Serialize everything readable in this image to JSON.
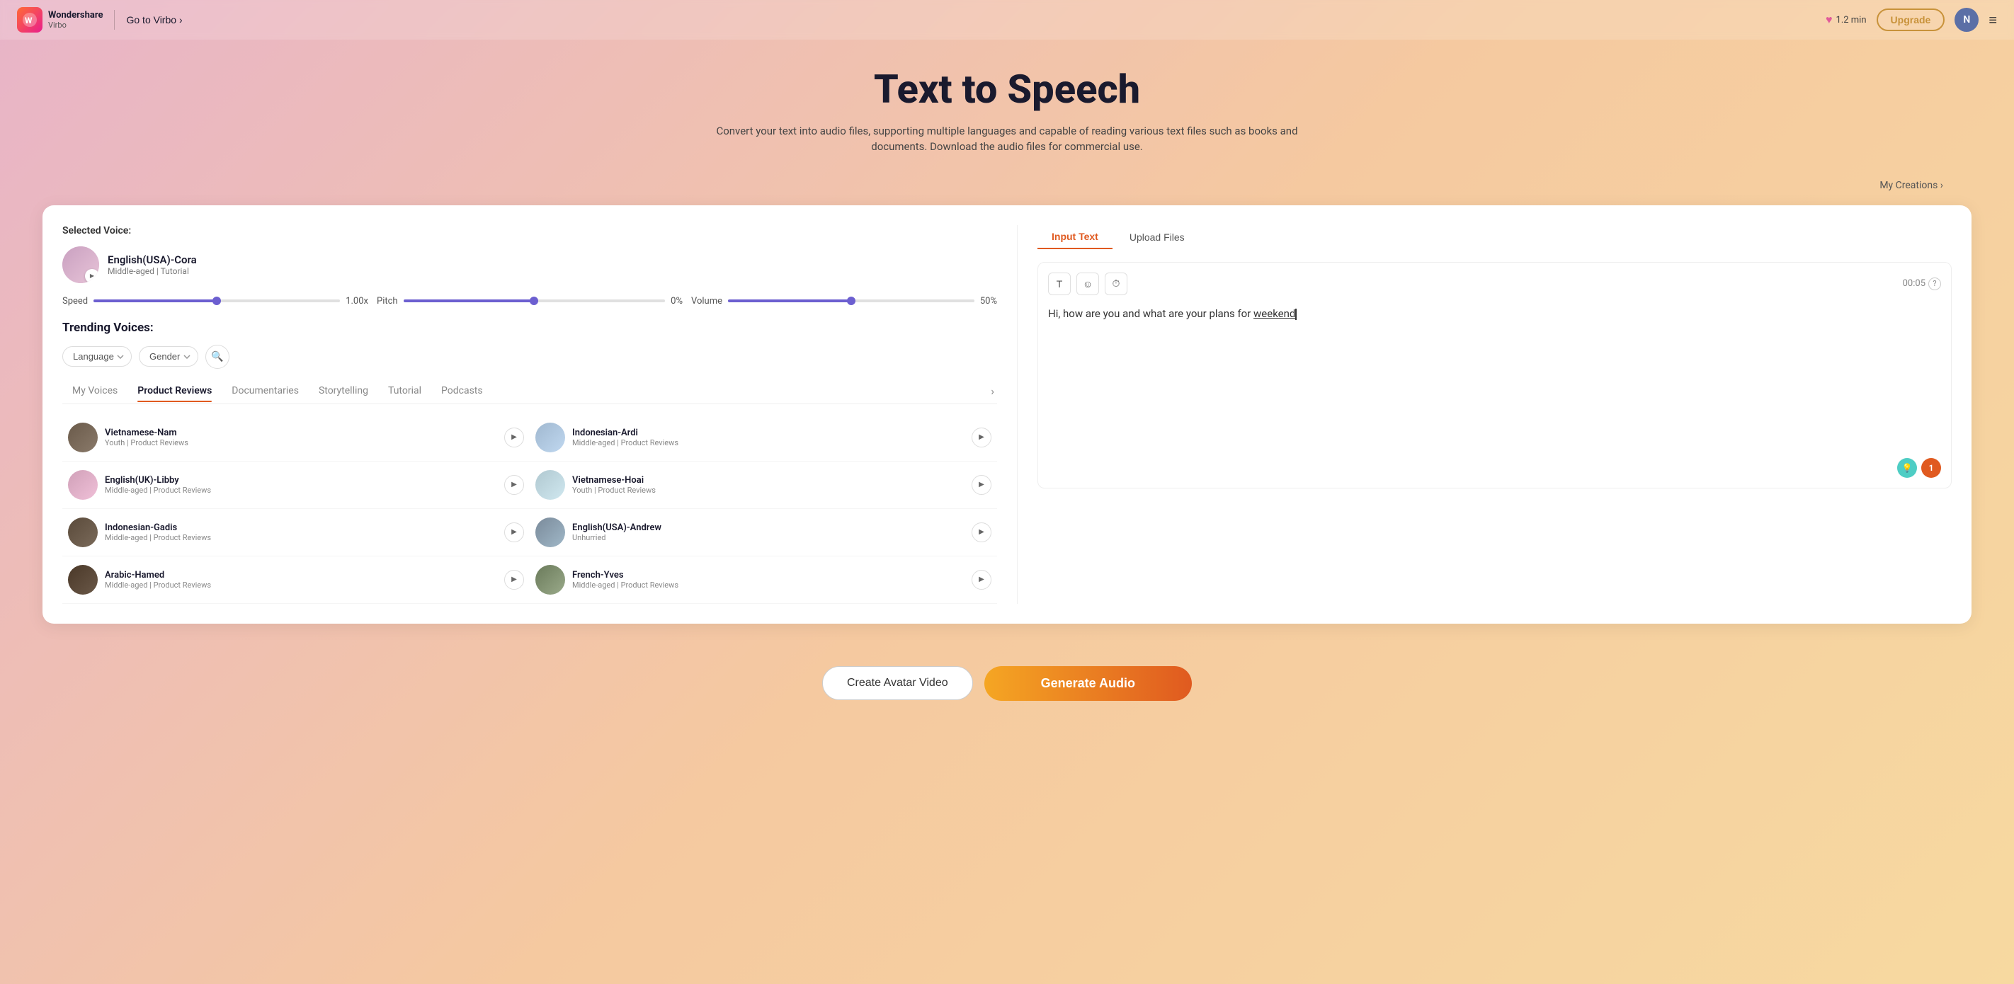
{
  "navbar": {
    "logo_text": "Wondershare",
    "logo_sub": "Virbo",
    "go_virbo_label": "Go to Virbo",
    "go_virbo_chevron": "›",
    "credits": "1.2 min",
    "upgrade_label": "Upgrade",
    "user_initial": "N",
    "menu_icon": "≡"
  },
  "hero": {
    "title": "Text to Speech",
    "subtitle": "Convert your text into audio files, supporting multiple languages and capable of reading various text files such as books and documents. Download the audio files for commercial use.",
    "my_creations_label": "My Creations ›"
  },
  "left_panel": {
    "selected_voice_label": "Selected Voice:",
    "selected_voice_name": "English(USA)-Cora",
    "selected_voice_meta": "Middle-aged | Tutorial",
    "controls": {
      "speed_label": "Speed",
      "speed_value": "1.00x",
      "speed_fill_pct": "50",
      "pitch_label": "Pitch",
      "pitch_value": "0%",
      "pitch_fill_pct": "50",
      "volume_label": "Volume",
      "volume_value": "50%",
      "volume_fill_pct": "50"
    },
    "trending_label": "Trending Voices:",
    "language_placeholder": "Language",
    "gender_placeholder": "Gender",
    "tabs": [
      {
        "id": "my-voices",
        "label": "My Voices",
        "active": false
      },
      {
        "id": "product-reviews",
        "label": "Product Reviews",
        "active": true
      },
      {
        "id": "documentaries",
        "label": "Documentaries",
        "active": false
      },
      {
        "id": "storytelling",
        "label": "Storytelling",
        "active": false
      },
      {
        "id": "tutorial",
        "label": "Tutorial",
        "active": false
      },
      {
        "id": "podcasts",
        "label": "Podcasts",
        "active": false
      }
    ],
    "voices": [
      {
        "name": "Vietnamese-Nam",
        "meta": "Youth | Product Reviews",
        "gender": "male"
      },
      {
        "name": "Indonesian-Ardi",
        "meta": "Middle-aged | Product Reviews",
        "gender": "male"
      },
      {
        "name": "English(UK)-Libby",
        "meta": "Middle-aged | Product Reviews",
        "gender": "female"
      },
      {
        "name": "Vietnamese-Hoai",
        "meta": "Youth | Product Reviews",
        "gender": "female"
      },
      {
        "name": "Indonesian-Gadis",
        "meta": "Middle-aged | Product Reviews",
        "gender": "female"
      },
      {
        "name": "English(USA)-Andrew",
        "meta": "Unhurried",
        "gender": "male"
      },
      {
        "name": "Arabic-Hamed",
        "meta": "Middle-aged | Product Reviews",
        "gender": "male"
      },
      {
        "name": "French-Yves",
        "meta": "Middle-aged | Product Reviews",
        "gender": "male"
      }
    ]
  },
  "right_panel": {
    "tab_input_text": "Input Text",
    "tab_upload_files": "Upload Files",
    "timer": "00:05",
    "input_text": "Hi, how are you and what are your plans for weekend?",
    "underline_word": "weekend",
    "notification_count": "1",
    "icon_text": "T",
    "icon_smile": "☺",
    "icon_clock": "⏱"
  },
  "bottom_actions": {
    "create_avatar_label": "Create Avatar Video",
    "generate_audio_label": "Generate Audio"
  }
}
